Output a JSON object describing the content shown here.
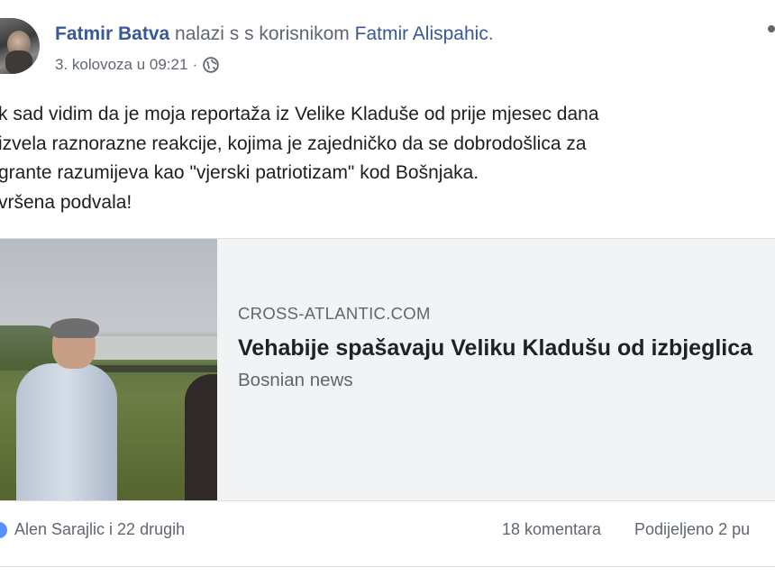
{
  "post": {
    "author_name": "Fatmir Batva",
    "with_text": " nalazi s s korisnikom ",
    "tagged_name": "Fatmir Alispahic",
    "tagged_suffix": ".",
    "timestamp": "3. kolovoza u 09:21",
    "meta_separator": "·",
    "privacy_icon": "globe-icon",
    "text_lines": [
      "k sad vidim da je moja reportaža iz Velike Kladuše od prije mjesec dana",
      "izvela raznorazne reakcije, kojima je zajedničko da se dobrodošlica za",
      "grante razumijeva kao \"vjerski patriotizam\" kod Bošnjaka.",
      "vršena podvala!"
    ]
  },
  "link_card": {
    "domain": "CROSS-ATLANTIC.COM",
    "title": "Vehabije spašavaju Veliku Kladušu od izbjeglica",
    "description": "Bosnian news"
  },
  "footer": {
    "reactions_text": "Alen Sarajlic i 22 drugih",
    "comments_text": "18 komentara",
    "shares_text": "Podijeljeno 2 pu"
  },
  "colors": {
    "link_blue": "#385898",
    "secondary_text": "#606770",
    "card_background": "#f2f3f5"
  }
}
